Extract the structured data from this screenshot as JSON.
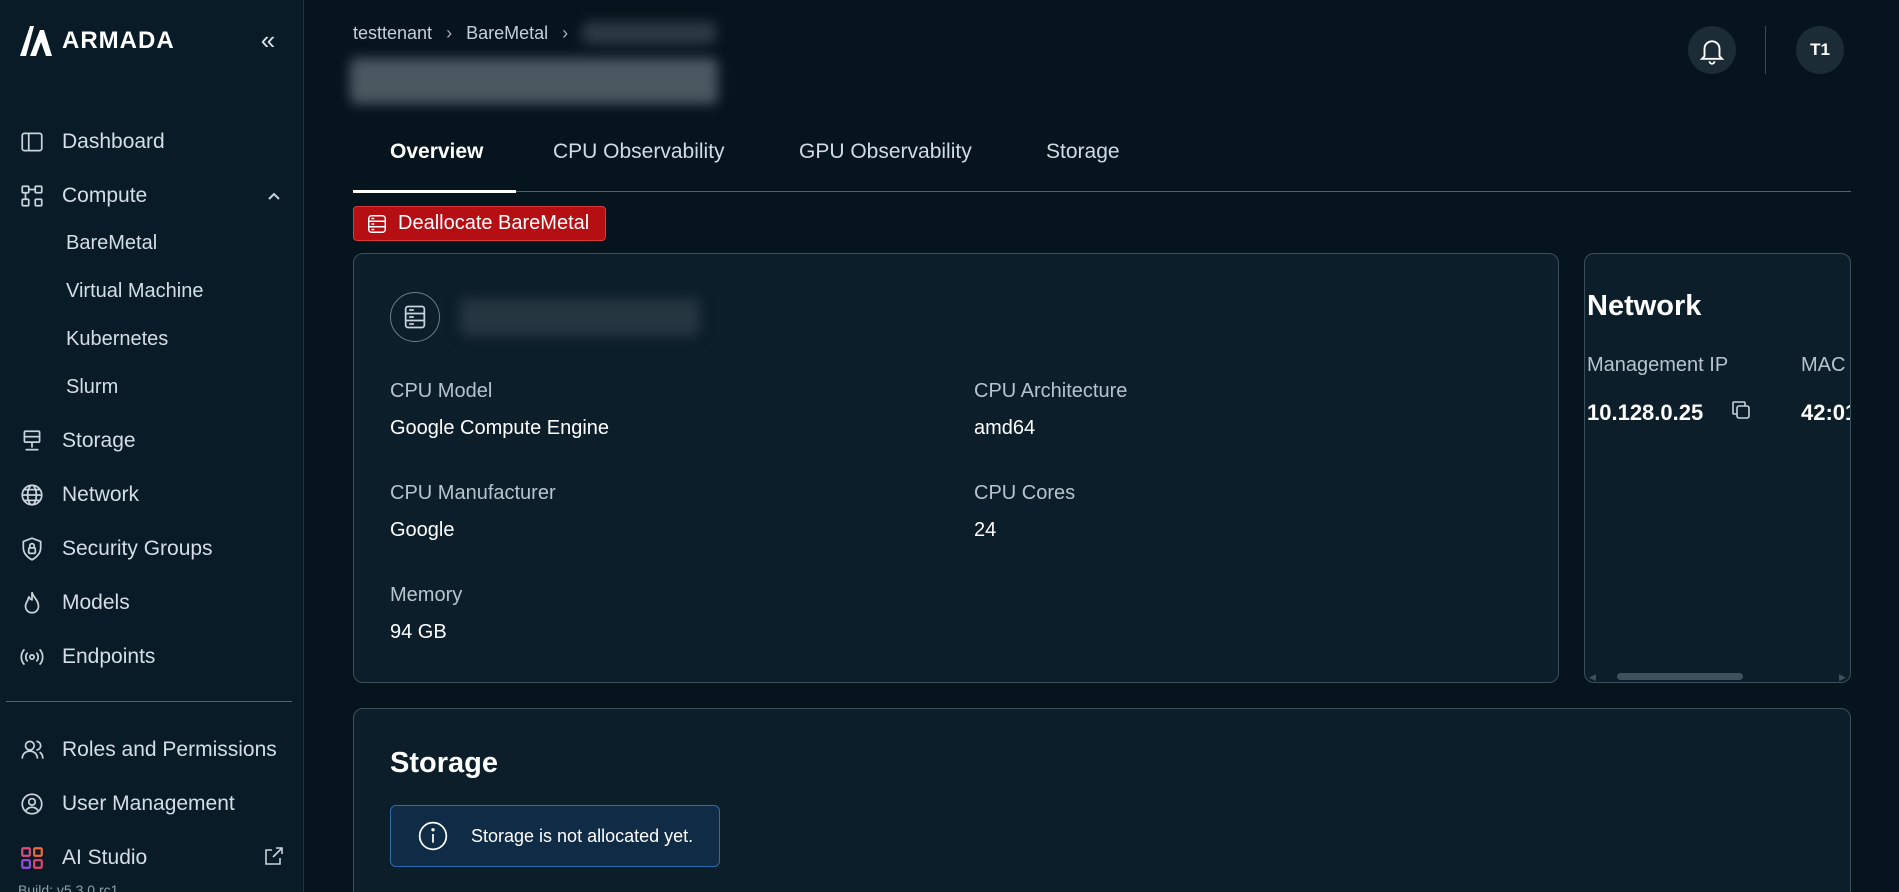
{
  "app": {
    "name": "ARMADA",
    "build": "Build: v5.3.0 rc1"
  },
  "sidebar": {
    "items": [
      {
        "label": "Dashboard",
        "icon": "dashboard-icon"
      },
      {
        "label": "Compute",
        "icon": "compute-icon",
        "expanded": true
      },
      {
        "label": "Storage",
        "icon": "storage-icon"
      },
      {
        "label": "Network",
        "icon": "globe-icon"
      },
      {
        "label": "Security Groups",
        "icon": "shield-icon"
      },
      {
        "label": "Models",
        "icon": "flame-icon"
      },
      {
        "label": "Endpoints",
        "icon": "broadcast-icon"
      }
    ],
    "compute_sub": [
      "BareMetal",
      "Virtual Machine",
      "Kubernetes",
      "Slurm"
    ],
    "bottom_items": [
      {
        "label": "Roles and Permissions",
        "icon": "users-icon"
      },
      {
        "label": "User Management",
        "icon": "user-gear-icon"
      },
      {
        "label": "AI Studio",
        "icon": "grid-icon"
      }
    ]
  },
  "header": {
    "breadcrumb": [
      "testtenant",
      "BareMetal"
    ],
    "avatar": "T1"
  },
  "tabs": [
    "Overview",
    "CPU Observability",
    "GPU Observability",
    "Storage"
  ],
  "actions": {
    "deallocate": "Deallocate BareMetal"
  },
  "details": {
    "cpu_model_label": "CPU Model",
    "cpu_model": "Google Compute Engine",
    "cpu_arch_label": "CPU Architecture",
    "cpu_arch": "amd64",
    "cpu_mfr_label": "CPU Manufacturer",
    "cpu_mfr": "Google",
    "cpu_cores_label": "CPU Cores",
    "cpu_cores": "24",
    "memory_label": "Memory",
    "memory": "94 GB"
  },
  "network": {
    "title": "Network",
    "mgmt_ip_label": "Management IP",
    "mgmt_ip": "10.128.0.25",
    "mac_label": "MAC",
    "mac": "42:01"
  },
  "storage": {
    "title": "Storage",
    "empty_message": "Storage is not allocated yet."
  },
  "colors": {
    "background": "#06141d",
    "sidebar": "#081b27",
    "danger": "#b50e13",
    "info_border": "#2d6cb3"
  }
}
